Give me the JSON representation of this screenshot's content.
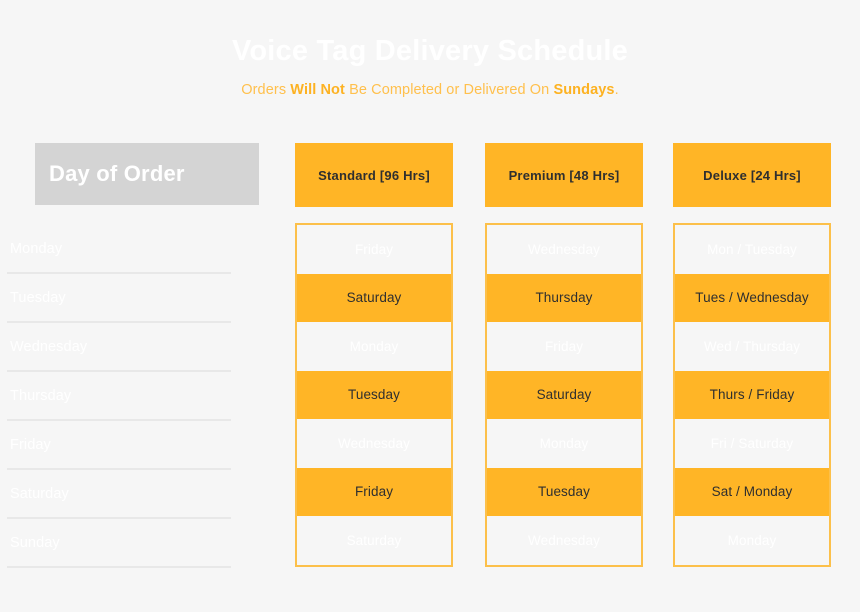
{
  "header": {
    "title": "Voice Tag Delivery Schedule",
    "subtitle": {
      "part1": "Orders ",
      "emphasis1": "Will Not",
      "part2": " Be Completed or Delivered On ",
      "emphasis2": "Sundays",
      "part3": "."
    }
  },
  "colors": {
    "background": "#f6f6f6",
    "accent_orange": "#ffb526",
    "accent_orange_light": "#fcc04a",
    "subtitle_orange": "#ffc04d",
    "day_header_gray": "#d4d4d4",
    "separator_gray": "#e8e8e8",
    "cell_dark_text": "#2f2f2f",
    "white_text": "#ffffff"
  },
  "table": {
    "day_column": {
      "header": "Day of Order",
      "days": [
        "Monday",
        "Tuesday",
        "Wednesday",
        "Thursday",
        "Friday",
        "Saturday",
        "Sunday"
      ]
    },
    "service_columns": [
      {
        "id": "standard",
        "header": "Standard [96 Hrs]",
        "cells": [
          "Friday",
          "Saturday",
          "Monday",
          "Tuesday",
          "Wednesday",
          "Friday",
          "Saturday"
        ]
      },
      {
        "id": "premium",
        "header": "Premium [48 Hrs]",
        "cells": [
          "Wednesday",
          "Thursday",
          "Friday",
          "Saturday",
          "Monday",
          "Tuesday",
          "Wednesday"
        ]
      },
      {
        "id": "deluxe",
        "header": "Deluxe [24 Hrs]",
        "cells": [
          "Mon / Tuesday",
          "Tues / Wednesday",
          "Wed / Thursday",
          "Thurs / Friday",
          "Fri / Saturday",
          "Sat / Monday",
          "Monday"
        ]
      }
    ]
  }
}
